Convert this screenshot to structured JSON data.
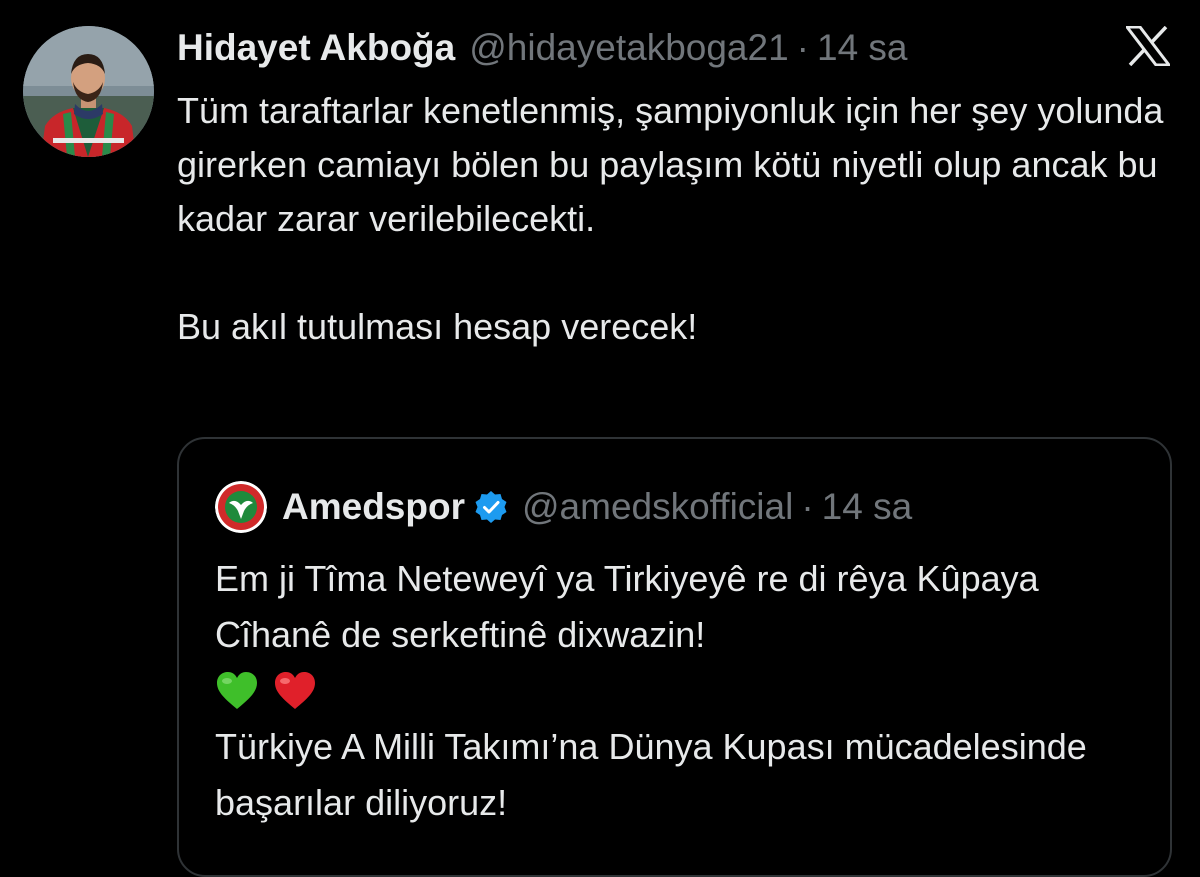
{
  "tweet": {
    "author_name": "Hidayet Akboğa",
    "author_handle": "@hidayetakboga21",
    "separator": "·",
    "timestamp": "14 sa",
    "text_para1": "Tüm taraftarlar kenetlenmiş, şampiyonluk için her şey yolunda girerken camiayı bölen bu paylaşım kötü niyetli olup ancak bu kadar zarar verilebilecekti.",
    "text_para2": "Bu akıl tutulması hesap verecek!"
  },
  "quoted_tweet": {
    "author_name": "Amedspor",
    "verified": true,
    "author_handle": "@amedskofficial",
    "separator": "·",
    "timestamp": "14 sa",
    "text_line1": "Em ji Tîma Neteweyî ya Tirkiyeyê re di rêya Kûpaya Cîhanê de serkeftinê dixwazin!",
    "emojis": [
      "green-heart",
      "red-heart"
    ],
    "text_line2": "Türkiye A Milli Takımı’na Dünya Kupası mücadelesinde başarılar diliyoruz!"
  },
  "icons": {
    "platform_logo": "x-logo-icon",
    "verified_badge": "verified-badge-icon"
  },
  "colors": {
    "background": "#000000",
    "text_primary": "#e7e9ea",
    "text_secondary": "#71767b",
    "border": "#2f3336",
    "verified_blue": "#1d9bf0",
    "green_heart": "#3fbf2a",
    "red_heart": "#e0202a"
  }
}
